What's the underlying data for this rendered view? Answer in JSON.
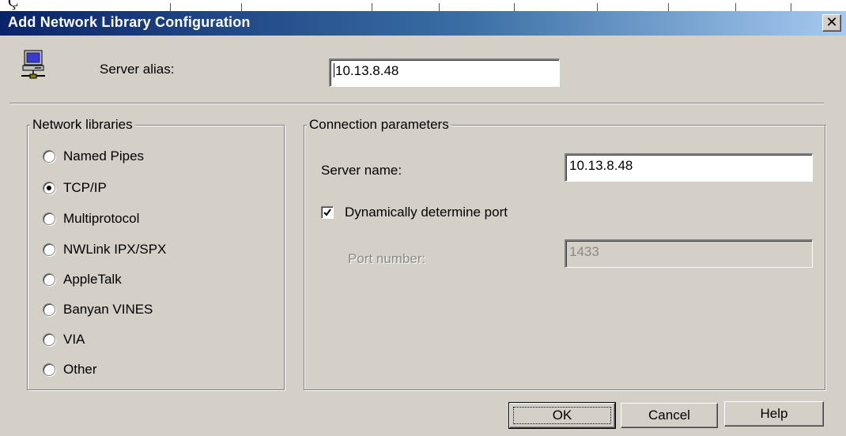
{
  "background": {
    "text_fragment": "Ç",
    "strip_color": "#ffffff"
  },
  "window": {
    "title": "Add Network Library Configuration",
    "close_glyph": "✕",
    "titlebar_colors": [
      "#0a246a",
      "#a6caf0"
    ]
  },
  "server_alias": {
    "label": "Server alias:",
    "value": "10.13.8.48",
    "icon": "network-computer-icon"
  },
  "network_libraries": {
    "title": "Network libraries",
    "options": [
      {
        "label": "Named Pipes",
        "selected": false
      },
      {
        "label": "TCP/IP",
        "selected": true
      },
      {
        "label": "Multiprotocol",
        "selected": false
      },
      {
        "label": "NWLink IPX/SPX",
        "selected": false
      },
      {
        "label": "AppleTalk",
        "selected": false
      },
      {
        "label": "Banyan VINES",
        "selected": false
      },
      {
        "label": "VIA",
        "selected": false
      },
      {
        "label": "Other",
        "selected": false
      }
    ]
  },
  "connection": {
    "title": "Connection parameters",
    "server_name_label": "Server name:",
    "server_name_value": "10.13.8.48",
    "dynamic_port_label": "Dynamically determine port",
    "dynamic_port_checked": true,
    "port_label": "Port number:",
    "port_value": "1433"
  },
  "buttons": {
    "ok": "OK",
    "cancel": "Cancel",
    "help": "Help"
  }
}
